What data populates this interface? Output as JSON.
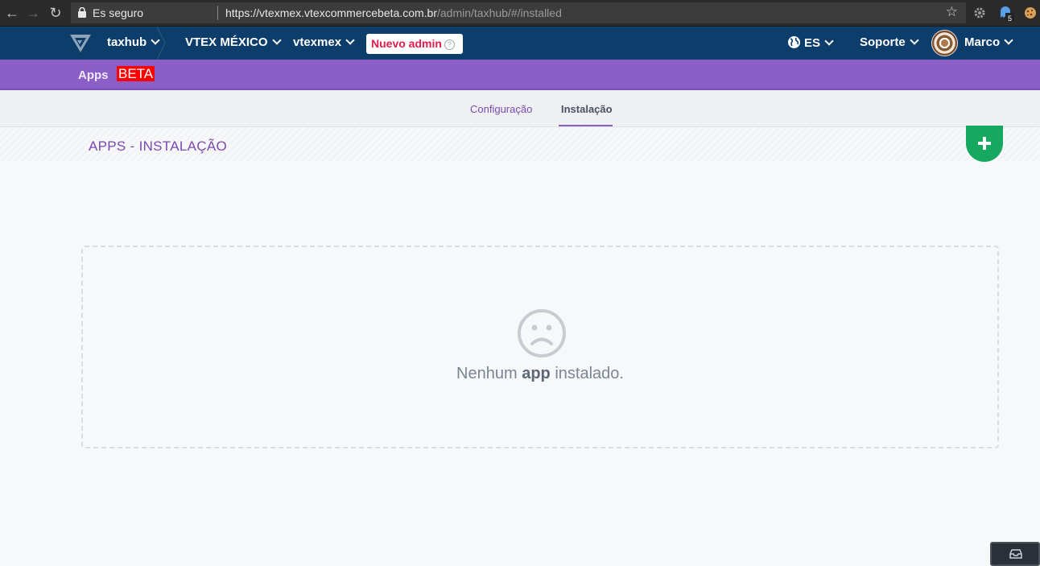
{
  "browser": {
    "secure_label": "Es seguro",
    "url_host": "https://vtexmex.vtexcommercebeta.com.br",
    "url_path": "/admin/taxhub/#/installed",
    "extension_badge": "5"
  },
  "topbar": {
    "app_name": "taxhub",
    "account": "VTEX MÉXICO",
    "store": "vtexmex",
    "nuevo_admin": "Nuevo admin",
    "language": "ES",
    "support": "Soporte",
    "user": "Marco"
  },
  "subbar": {
    "apps_label": "Apps",
    "beta_label": "BETA"
  },
  "tabs": [
    {
      "label": "Configuração",
      "active": false
    },
    {
      "label": "Instalação",
      "active": true
    }
  ],
  "page": {
    "title": "APPS - INSTALAÇÃO",
    "empty_prefix": "Nenhum ",
    "empty_bold": "app",
    "empty_suffix": " instalado."
  },
  "colors": {
    "topbar": "#0d3d6b",
    "purple": "#8b5fc7",
    "fab_green": "#16a85f",
    "nuevo_red": "#e11d48",
    "beta_red": "#ff0000"
  }
}
